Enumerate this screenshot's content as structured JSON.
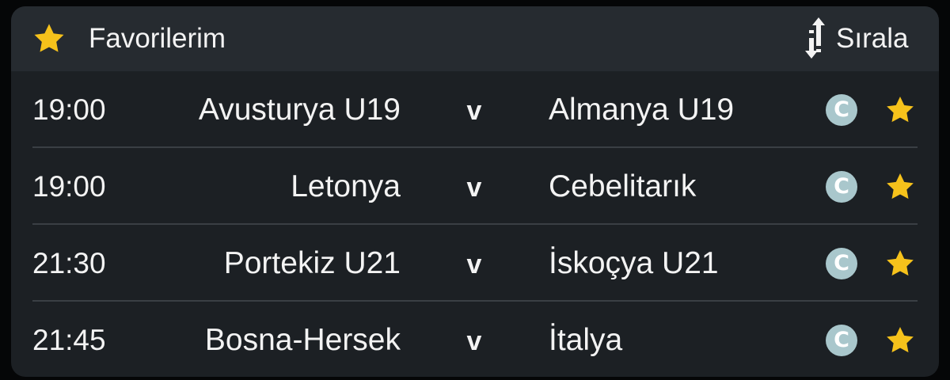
{
  "header": {
    "title": "Favorilerim",
    "sort_label": "Sırala"
  },
  "colors": {
    "star": "#f6c21b",
    "badge": "#a9c7cc",
    "card_bg": "#1c2024",
    "header_bg": "#262b30"
  },
  "matches": [
    {
      "time": "19:00",
      "home": "Avusturya U19",
      "vs": "v",
      "away": "Almanya U19",
      "badge": "C"
    },
    {
      "time": "19:00",
      "home": "Letonya",
      "vs": "v",
      "away": "Cebelitarık",
      "badge": "C"
    },
    {
      "time": "21:30",
      "home": "Portekiz U21",
      "vs": "v",
      "away": "İskoçya U21",
      "badge": "C"
    },
    {
      "time": "21:45",
      "home": "Bosna-Hersek",
      "vs": "v",
      "away": "İtalya",
      "badge": "C"
    }
  ]
}
